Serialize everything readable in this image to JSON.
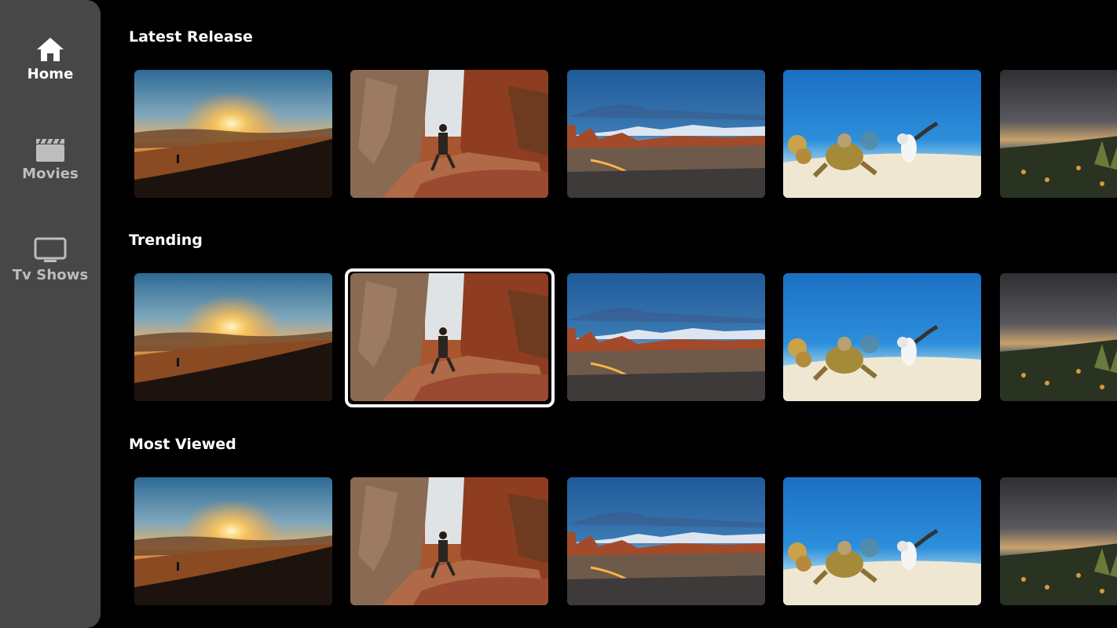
{
  "sidebar": {
    "items": [
      {
        "label": "Home",
        "icon": "home-icon",
        "active": true
      },
      {
        "label": "Movies",
        "icon": "clapperboard-icon",
        "active": false
      },
      {
        "label": "Tv Shows",
        "icon": "tv-icon",
        "active": false
      }
    ]
  },
  "rows": [
    {
      "title": "Latest Release",
      "items": [
        "desert-sunset-hiker",
        "canyon-hiker",
        "red-rock-desert-night",
        "underwater-turtle-diver",
        "stormy-coast"
      ]
    },
    {
      "title": "Trending",
      "items": [
        "desert-sunset-hiker",
        "canyon-hiker",
        "red-rock-desert-night",
        "underwater-turtle-diver",
        "stormy-coast"
      ],
      "focused_index": 1
    },
    {
      "title": "Most Viewed",
      "items": [
        "desert-sunset-hiker",
        "canyon-hiker",
        "red-rock-desert-night",
        "underwater-turtle-diver",
        "stormy-coast"
      ]
    }
  ],
  "colors": {
    "background": "#000000",
    "sidebar": "#474747",
    "active_text": "#ffffff",
    "inactive_text": "#bdbdbd"
  }
}
